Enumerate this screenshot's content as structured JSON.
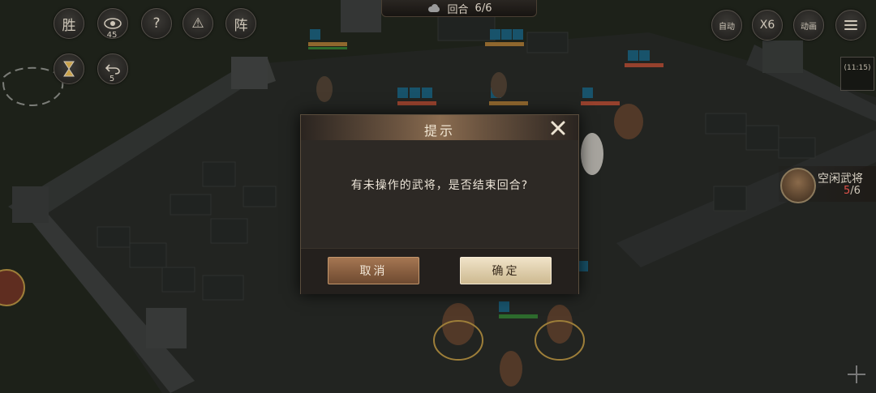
{
  "top_bar": {
    "round_label": "回合",
    "round_value": "6/6"
  },
  "left_buttons": {
    "victory": "胜",
    "vision_count": "45",
    "help": "?",
    "warning": "⚠",
    "formation": "阵",
    "undo_count": "5"
  },
  "right_buttons": {
    "auto": "自动",
    "speed": "X6",
    "animation": "动画"
  },
  "right_panel": {
    "time_label": "",
    "time_value": "(11:15)",
    "idle_label": "空闲武将",
    "idle_current": "5",
    "idle_total": "/6"
  },
  "dialog": {
    "title": "提示",
    "message": "有未操作的武将，是否结束回合?",
    "cancel_label": "取消",
    "confirm_label": "确定"
  },
  "icons": {
    "weather": "cloud-icon",
    "hourglass": "hourglass-icon",
    "undo": "undo-icon",
    "menu": "menu-icon",
    "close": "close-icon",
    "vision": "eye-icon"
  },
  "colors": {
    "accent": "#8a6c50",
    "confirm_bg": "#e6d6b6",
    "cancel_bg": "#8c6141",
    "idle_count": "#e0524a"
  }
}
